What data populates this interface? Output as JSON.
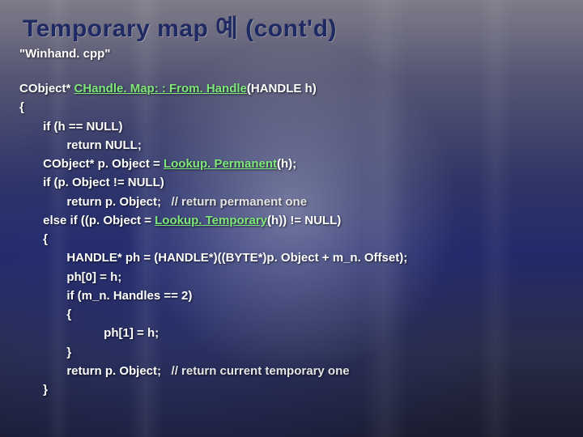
{
  "title": "Temporary map 예 (cont'd)",
  "subtitle": "\"Winhand. cpp\"",
  "code": {
    "l01a": "CObject* ",
    "l01b": "CHandle. Map: : From. Handle",
    "l01c": "(HANDLE h)",
    "l02": "{",
    "l03": "       if (h == NULL)",
    "l04": "              return NULL;",
    "l05a": "       CObject* p. Object = ",
    "l05b": "Lookup. Permanent",
    "l05c": "(h);",
    "l06": "       if (p. Object != NULL)",
    "l07a": "              return p. Object;   ",
    "l07b": "// return permanent one",
    "l08a": "       else if ((p. Object = ",
    "l08b": "Lookup. Temporary",
    "l08c": "(h)) != NULL)",
    "l09": "       {",
    "l10": "              HANDLE* ph = (HANDLE*)((BYTE*)p. Object + m_n. Offset);",
    "l11": "              ph[0] = h;",
    "l12": "              if (m_n. Handles == 2)",
    "l13": "              {",
    "l14": "                         ph[1] = h;",
    "l15": "              }",
    "l16a": "              return p. Object;   ",
    "l16b": "// return current temporary one",
    "l17": "       }"
  }
}
